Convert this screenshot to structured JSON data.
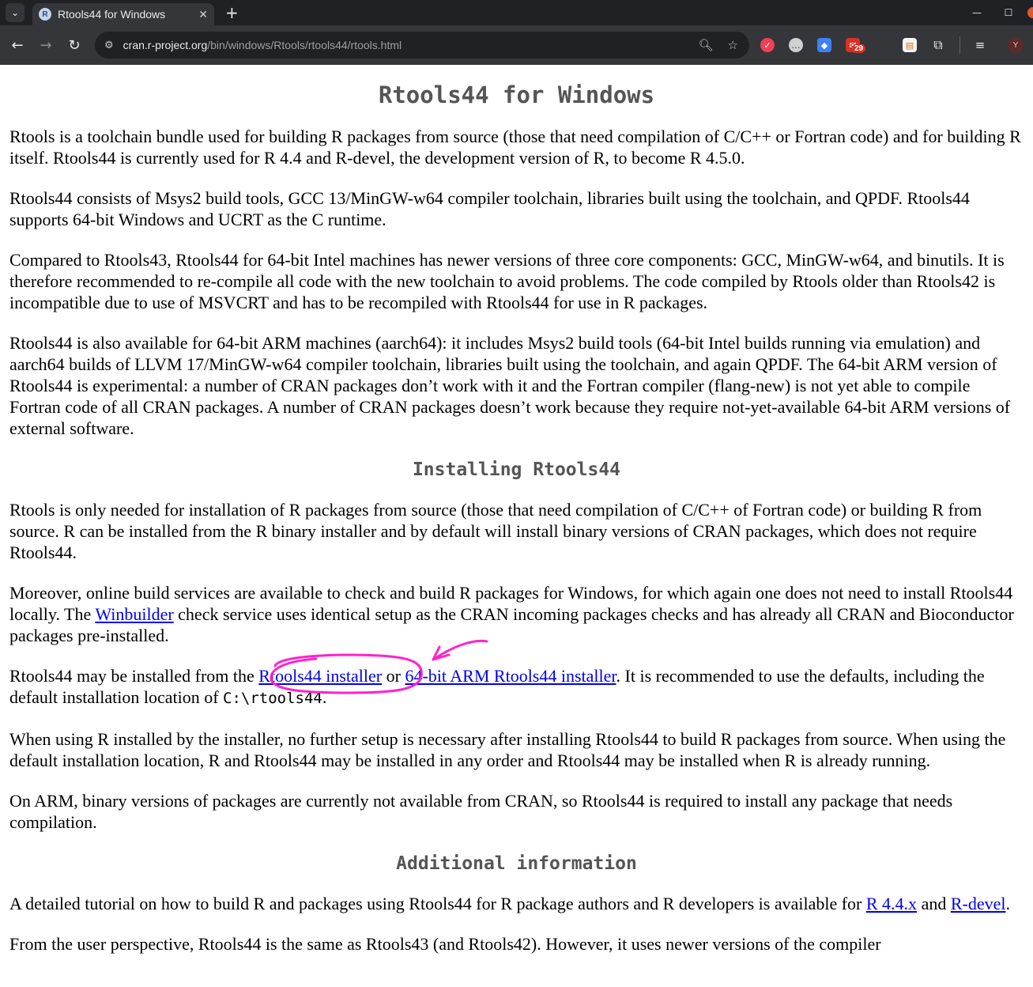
{
  "browser": {
    "tab_title": "Rtools44 for Windows",
    "tab_close": "✕",
    "new_tab": "+",
    "url_host": "cran.r-project.org",
    "url_path": "/bin/windows/Rtools/rtools44/rtools.html",
    "mail_badge": "29",
    "avatar_letter": "Y"
  },
  "page": {
    "title": "Rtools44 for Windows",
    "p1": "Rtools is a toolchain bundle used for building R packages from source (those that need compilation of C/C++ or Fortran code) and for building R itself. Rtools44 is currently used for R 4.4 and R-devel, the development version of R, to become R 4.5.0.",
    "p2": "Rtools44 consists of Msys2 build tools, GCC 13/MinGW-w64 compiler toolchain, libraries built using the toolchain, and QPDF. Rtools44 supports 64-bit Windows and UCRT as the C runtime.",
    "p3": "Compared to Rtools43, Rtools44 for 64-bit Intel machines has newer versions of three core components: GCC, MinGW-w64, and binutils. It is therefore recommended to re-compile all code with the new toolchain to avoid problems. The code compiled by Rtools older than Rtools42 is incompatible due to use of MSVCRT and has to be recompiled with Rtools44 for use in R packages.",
    "p4": "Rtools44 is also available for 64-bit ARM machines (aarch64): it includes Msys2 build tools (64-bit Intel builds running via emulation) and aarch64 builds of LLVM 17/MinGW-w64 compiler toolchain, libraries built using the toolchain, and again QPDF. The 64-bit ARM version of Rtools44 is experimental: a number of CRAN packages don’t work with it and the Fortran compiler (flang-new) is not yet able to compile Fortran code of all CRAN packages. A number of CRAN packages doesn’t work because they require not-yet-available 64-bit ARM versions of external software.",
    "h_install": "Installing Rtools44",
    "p5": "Rtools is only needed for installation of R packages from source (those that need compilation of C/C++ of Fortran code) or building R from source. R can be installed from the R binary installer and by default will install binary versions of CRAN packages, which does not require Rtools44.",
    "p6_a": "Moreover, online build services are available to check and build R packages for Windows, for which again one does not need to install Rtools44 locally. The ",
    "p6_link": "Winbuilder",
    "p6_b": " check service uses identical setup as the CRAN incoming packages checks and has already all CRAN and Bioconductor packages pre-installed.",
    "p7_a": "Rtools44 may be installed from the ",
    "p7_link1": "Rtools44 installer",
    "p7_b": " or ",
    "p7_link2": "64-bit ARM Rtools44 installer",
    "p7_c": ". It is recommended to use the defaults, including the default installation location of ",
    "p7_code": "C:\\rtools44",
    "p7_d": ".",
    "p8": "When using R installed by the installer, no further setup is necessary after installing Rtools44 to build R packages from source. When using the default installation location, R and Rtools44 may be installed in any order and Rtools44 may be installed when R is already running.",
    "p9": "On ARM, binary versions of packages are currently not available from CRAN, so Rtools44 is required to install any package that needs compilation.",
    "h_additional": "Additional information",
    "p10_a": "A detailed tutorial on how to build R and packages using Rtools44 for R package authors and R developers is available for ",
    "p10_link1": "R 4.4.x",
    "p10_b": " and ",
    "p10_link2": "R-devel",
    "p10_c": ".",
    "p11": "From the user perspective, Rtools44 is the same as Rtools43 (and Rtools42). However, it uses newer versions of the compiler"
  },
  "annotation_color": "#ff22cc"
}
